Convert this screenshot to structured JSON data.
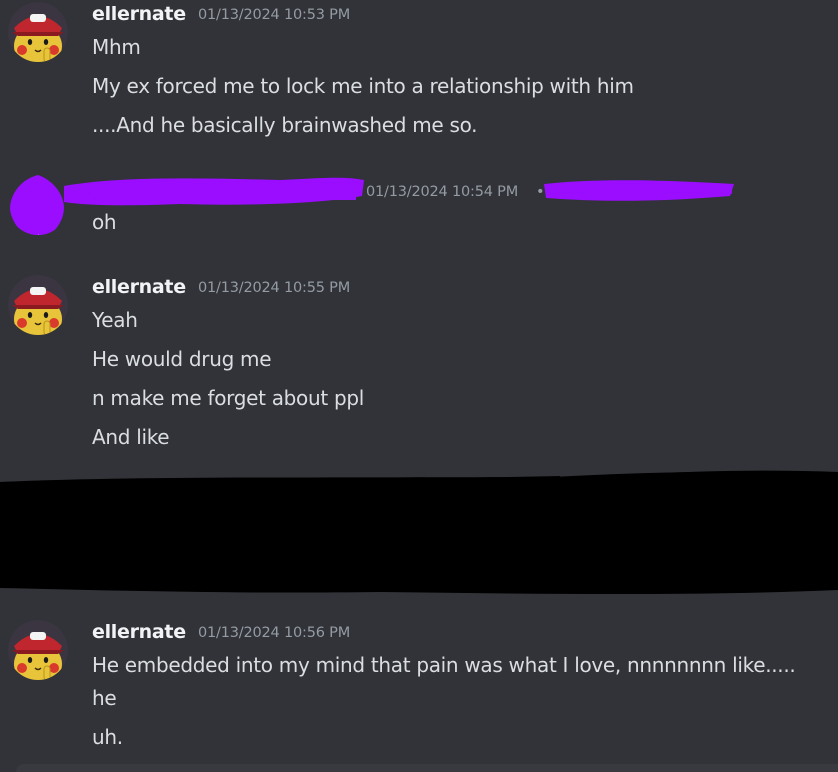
{
  "messages": [
    {
      "author": "ellernate",
      "timestamp": "01/13/2024 10:53 PM",
      "lines": [
        "Mhm",
        "My ex forced me to lock me into a relationship with him",
        "....And he basically brainwashed me so."
      ]
    },
    {
      "author": "",
      "timestamp": "01/13/2024 10:54 PM",
      "separator": "•",
      "lines": [
        "oh"
      ]
    },
    {
      "author": "ellernate",
      "timestamp": "01/13/2024 10:55 PM",
      "lines": [
        "Yeah",
        "He would drug me",
        "n make me forget about ppl",
        "And like"
      ]
    },
    {
      "author": "ellernate",
      "timestamp": "01/13/2024 10:56 PM",
      "lines": [
        "He embedded into my mind that pain was what I love, nnnnnnnn like.....",
        "he",
        "uh."
      ]
    }
  ],
  "colors": {
    "background": "#313338",
    "username": "#f2f3f5",
    "timestamp": "#949ba4",
    "message_text": "#dbdee1",
    "redaction_purple": "#9a0dff",
    "redaction_black": "#000000"
  },
  "icons": {
    "avatar": "pikachu-with-cap-avatar"
  }
}
